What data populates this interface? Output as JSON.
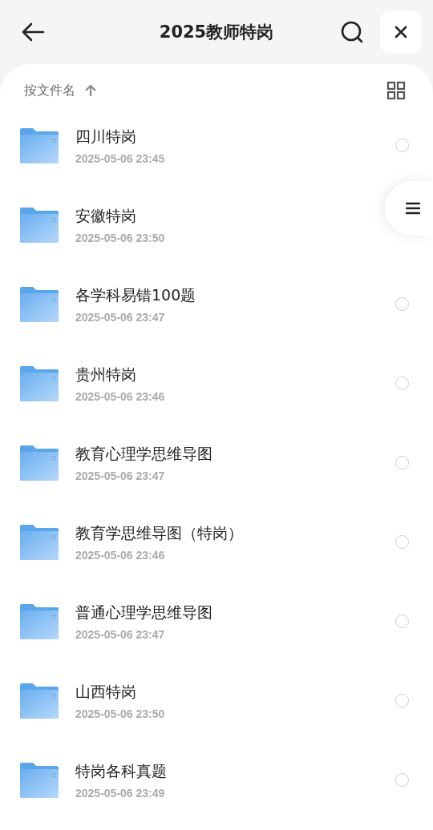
{
  "header": {
    "title": "2025教师特岗"
  },
  "sort": {
    "label": "按文件名",
    "ascending": true
  },
  "files": [
    {
      "name": "四川特岗",
      "time": "2025-05-06 23:45",
      "selected": false
    },
    {
      "name": "安徽特岗",
      "time": "2025-05-06 23:50"
    },
    {
      "name": "各学科易错100题",
      "time": "2025-05-06 23:47",
      "selected": false
    },
    {
      "name": "贵州特岗",
      "time": "2025-05-06 23:46",
      "selected": false
    },
    {
      "name": "教育心理学思维导图",
      "time": "2025-05-06 23:47",
      "selected": false
    },
    {
      "name": "教育学思维导图（特岗）",
      "time": "2025-05-06 23:46",
      "selected": false
    },
    {
      "name": "普通心理学思维导图",
      "time": "2025-05-06 23:47",
      "selected": false
    },
    {
      "name": "山西特岗",
      "time": "2025-05-06 23:50",
      "selected": false
    },
    {
      "name": "特岗各科真题",
      "time": "2025-05-06 23:49",
      "selected": false
    }
  ]
}
